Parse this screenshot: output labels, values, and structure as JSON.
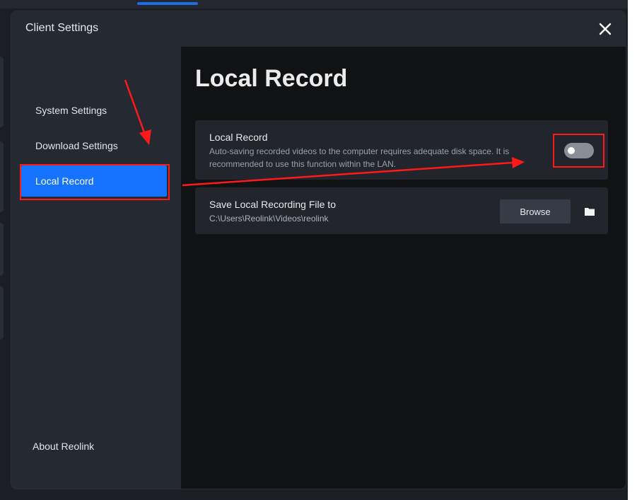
{
  "dialog": {
    "title": "Client Settings",
    "close_icon": "close-icon"
  },
  "sidebar": {
    "items": [
      {
        "label": "System Settings",
        "active": false
      },
      {
        "label": "Download Settings",
        "active": false
      },
      {
        "label": "Local Record",
        "active": true
      }
    ],
    "about_label": "About Reolink"
  },
  "main": {
    "title": "Local Record",
    "local_record": {
      "label": "Local Record",
      "description": "Auto-saving recorded videos to the computer requires adequate disk space. It is recommended to use this function within the LAN.",
      "enabled": false
    },
    "save_path": {
      "label": "Save Local Recording File to",
      "path": "C:\\Users\\Reolink\\Videos\\reolink",
      "browse_label": "Browse",
      "folder_icon": "folder-icon"
    }
  },
  "colors": {
    "accent": "#1673ff",
    "annotation": "#ff1a1a"
  }
}
